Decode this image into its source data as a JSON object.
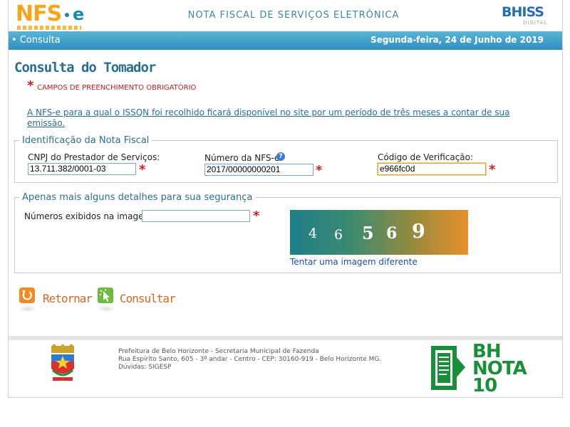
{
  "header": {
    "logo_main": "NFS",
    "logo_e": "e",
    "title": "NOTA FISCAL DE SERVIÇOS ELETRÔNICA",
    "partner_logo": "BHISS",
    "partner_logo_sub": "DIGITAL"
  },
  "navbar": {
    "item": "• Consulta",
    "date": "Segunda-feira, 24 de Junho de 2019",
    "bg_color": "#2e8fbf"
  },
  "page": {
    "heading": "Consulta do Tomador",
    "required_note": "CAMPOS DE PREENCHIMENTO OBRIGATÓRIO",
    "info_link": "A NFS-e para a qual o ISSQN foi recolhido ficará disponível no site por um período de três meses a contar de sua emissão."
  },
  "identification": {
    "legend": "Identificação da Nota Fiscal",
    "cnpj_label": "CNPJ do Prestador de Serviços:",
    "cnpj_value": "13.711.382/0001-03",
    "nfse_label": "Número da NFS-e:",
    "nfse_value": "2017/00000000201",
    "help_icon": "?",
    "code_label": "Código de Verificação:",
    "code_value": "e966fc0d"
  },
  "security": {
    "legend": "Apenas mais alguns detalhes para sua segurança",
    "captcha_label": "Números exibidos na imagem:",
    "captcha_value": "",
    "captcha_digits": [
      "4",
      "6",
      "5",
      "6",
      "9"
    ],
    "refresh_link": "Tentar uma imagem diferente"
  },
  "actions": {
    "back_label": "Retornar",
    "back_icon": "return-arrow-icon",
    "submit_label": "Consultar",
    "submit_icon": "click-cursor-icon"
  },
  "footer": {
    "line1": "Prefeitura de Belo Horizonte - Secretaria Municipal de Fazenda",
    "line2": "Rua Espírito Santo, 605 - 3º andar - Centro - CEP: 30160-919 - Belo Horizonte MG.",
    "line3": "Dúvidas: SIGESP",
    "bh_logo_line1": "BH",
    "bh_logo_line2": "NOTA",
    "bh_logo_line3": "10"
  },
  "colors": {
    "accent": "#2b6e8c",
    "required": "#c7211f",
    "action": "#d0691e"
  }
}
